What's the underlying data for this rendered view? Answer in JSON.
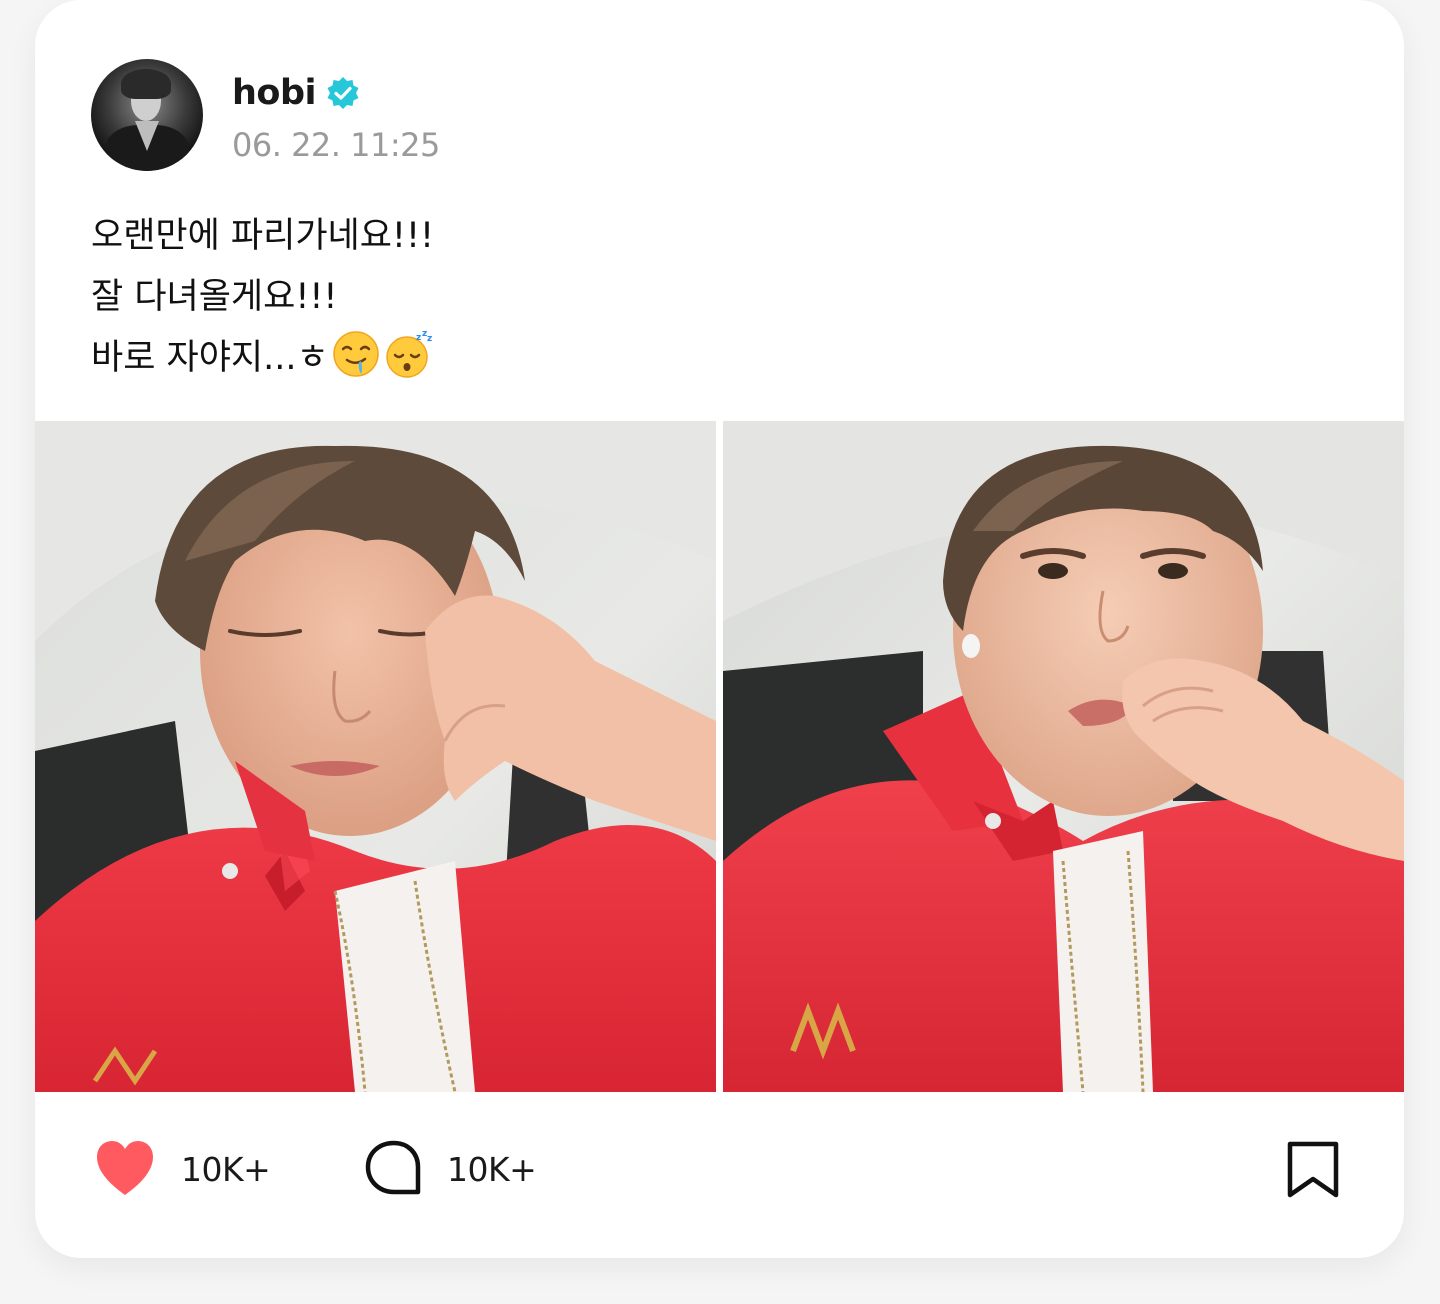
{
  "post": {
    "author": {
      "name": "hobi",
      "verified": true,
      "avatar_icon": "avatar-photo"
    },
    "timestamp": "06. 22. 11:25",
    "text_lines": [
      "오랜만에 파리가네요!!!",
      "잘 다녀올게요!!!",
      "바로 자야지...ㅎ"
    ],
    "text_emojis": [
      "drooling-face-emoji",
      "sleeping-face-emoji"
    ],
    "photos": [
      {
        "description_icon": "photo-sleeping"
      },
      {
        "description_icon": "photo-awake"
      }
    ]
  },
  "actions": {
    "likes": "10K+",
    "comments": "10K+",
    "like_icon": "heart-icon",
    "comment_icon": "speech-bubble-icon",
    "bookmark_icon": "bookmark-icon"
  },
  "colors": {
    "verified": "#25c7d8",
    "heart": "#ff5a5f",
    "timestamp": "#9a9a9a",
    "jacket": "#e8303f"
  }
}
